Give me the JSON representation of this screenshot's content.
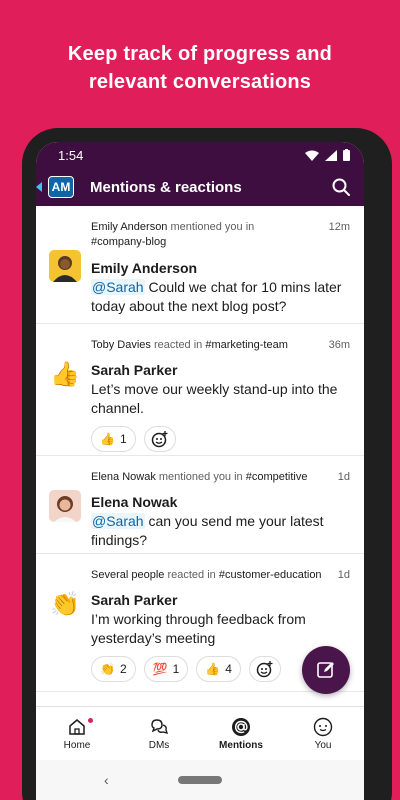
{
  "headline": "Keep track of progress and\nrelevant conversations",
  "status": {
    "time": "1:54"
  },
  "appbar": {
    "avatar_initials": "AM",
    "title": "Mentions & reactions"
  },
  "feed": [
    {
      "actor": "Emily Anderson",
      "action": "mentioned you in",
      "channel": "#company-blog",
      "time": "12m",
      "name": "Emily Anderson",
      "mention": "@Sarah",
      "message": " Could we chat for 10 mins later today about the next blog post?"
    },
    {
      "actor": "Toby Davies",
      "action": "reacted in",
      "channel": "#marketing-team",
      "time": "36m",
      "name": "Sarah Parker",
      "message": "Let’s move our weekly stand-up into the channel.",
      "reactions": [
        {
          "emoji": "👍",
          "count": "1"
        }
      ]
    },
    {
      "actor": "Elena Nowak",
      "action": "mentioned you in",
      "channel": "#competitive",
      "time": "1d",
      "name": "Elena Nowak",
      "mention": "@Sarah",
      "message": " can you send me your latest findings?"
    },
    {
      "actor": "Several people",
      "action": "reacted in",
      "channel": "#customer-education",
      "time": "1d",
      "name": "Sarah Parker",
      "message": "I’m working through feedback from yesterday’s meeting",
      "reactions": [
        {
          "emoji": "👏",
          "count": "2"
        },
        {
          "emoji": "💯",
          "count": "1"
        },
        {
          "emoji": "👍",
          "count": "4"
        }
      ]
    }
  ],
  "nav": [
    {
      "label": "Home"
    },
    {
      "label": "DMs"
    },
    {
      "label": "Mentions"
    },
    {
      "label": "You"
    }
  ],
  "colors": {
    "brand": "#e01e5a",
    "aubergine": "#3f0e40",
    "fab": "#4a154b",
    "link": "#1264a3"
  }
}
